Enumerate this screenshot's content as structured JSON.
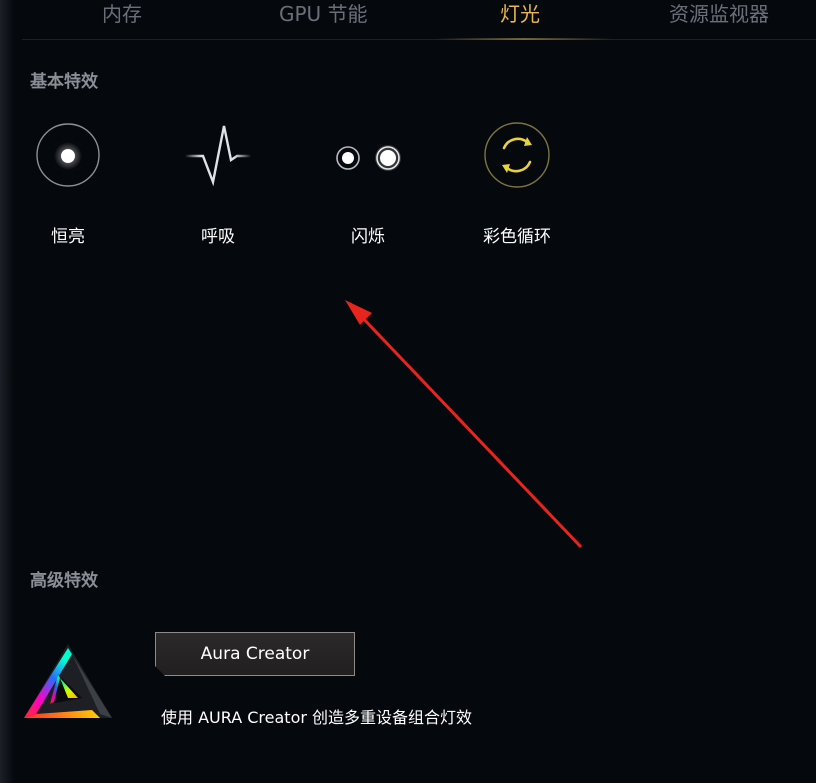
{
  "tabs": [
    {
      "label": "内存"
    },
    {
      "label": "GPU 节能"
    },
    {
      "label": "灯光",
      "active": true
    },
    {
      "label": "资源监视器"
    }
  ],
  "basic_section": {
    "title": "基本特效",
    "effects": [
      {
        "label": "恒亮",
        "icon": "static-light-icon"
      },
      {
        "label": "呼吸",
        "icon": "breathing-wave-icon"
      },
      {
        "label": "闪烁",
        "icon": "strobing-dots-icon"
      },
      {
        "label": "彩色循环",
        "icon": "color-cycle-icon"
      }
    ]
  },
  "advanced_section": {
    "title": "高级特效",
    "button_label": "Aura Creator",
    "description": "使用 AURA Creator 创造多重设备组合灯效",
    "logo": "aura-creator-logo-icon"
  },
  "colors": {
    "background": "#05080d",
    "active_tab": "#e8b84a",
    "inactive_tab": "#6b7078",
    "section_title": "#8a8f96",
    "annotation_arrow": "#e8241c",
    "color_cycle_accent": "#e8d23a"
  }
}
